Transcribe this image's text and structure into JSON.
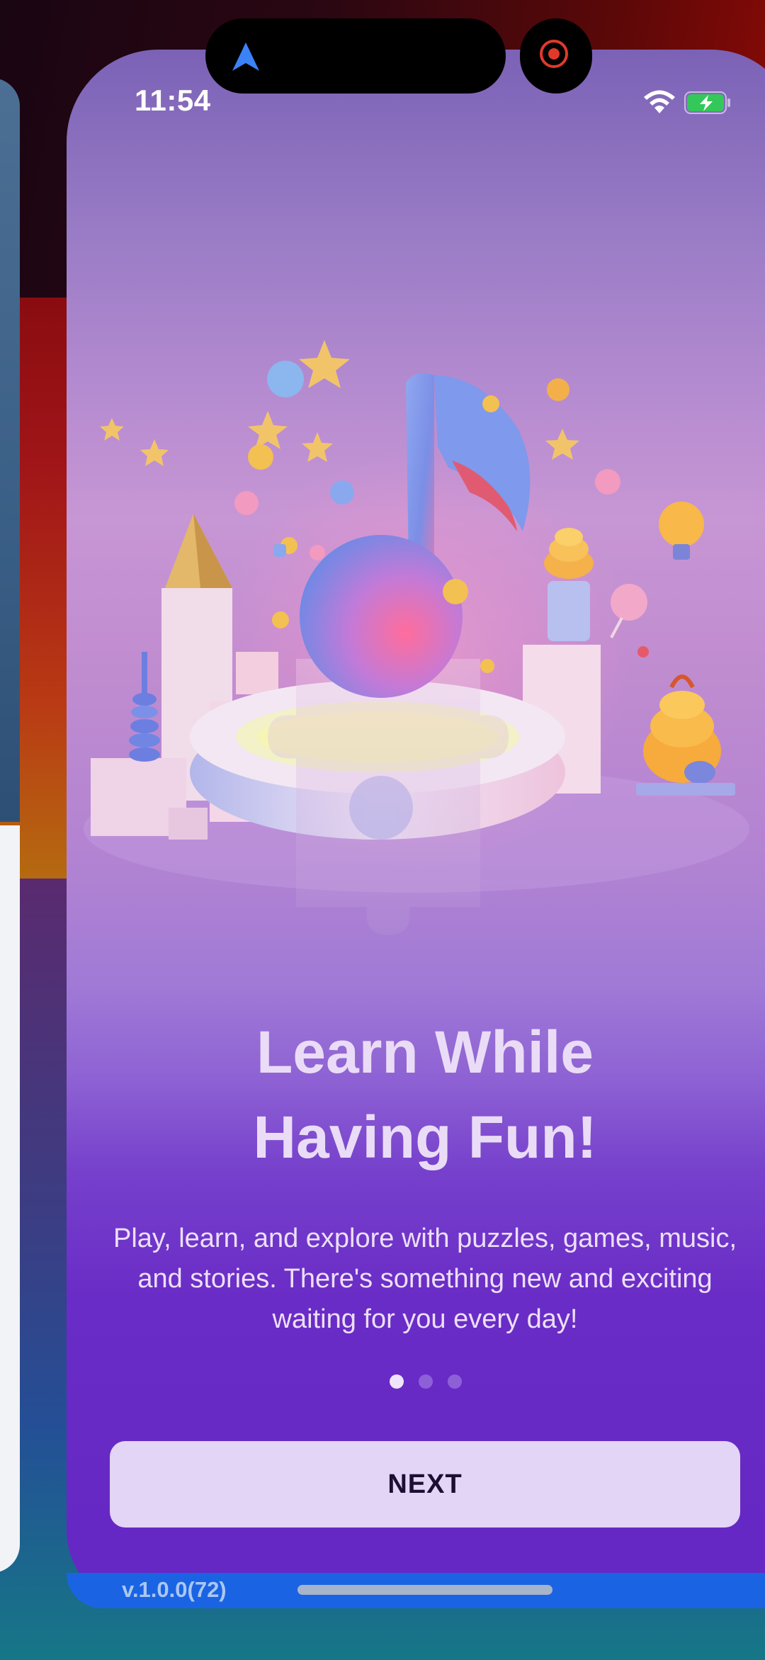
{
  "status_bar": {
    "time": "11:54",
    "icons": [
      "location-arrow-icon",
      "screen-recording-icon",
      "wifi-icon",
      "battery-charging-icon"
    ],
    "battery_color": "#34c759",
    "recording_color": "#e0392b"
  },
  "onboarding": {
    "illustration": "music-note-puzzle-illustration",
    "title_line1": "Learn While",
    "title_line2": "Having Fun!",
    "description": "Play, learn, and explore with puzzles, games, music, and stories. There's something new and exciting waiting for you every day!",
    "page_indicator": {
      "total": 3,
      "current": 1
    },
    "next_label": "NEXT"
  },
  "footer": {
    "version": "v.1.0.0(72)"
  },
  "colors": {
    "background_top": "#7b62b6",
    "background_bottom": "#6427c3",
    "button_bg": "#e2d5f5",
    "button_text": "#1b1033",
    "title_text": "#eadcf6",
    "footer_bar": "#1a64e3"
  }
}
